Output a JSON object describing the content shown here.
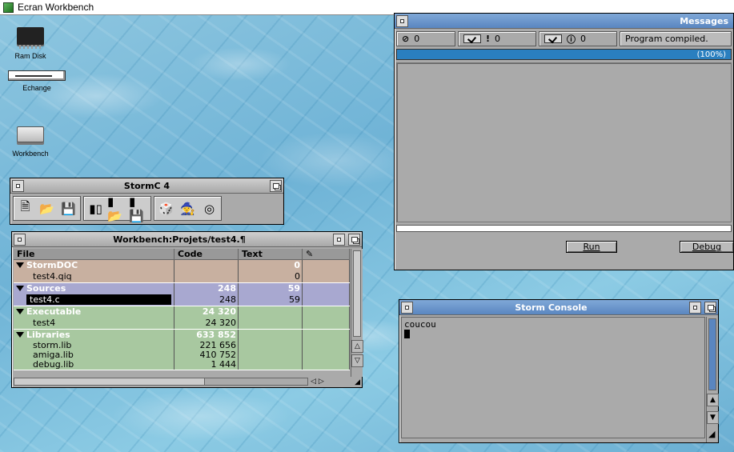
{
  "screen": {
    "title": "Ecran Workbench"
  },
  "desktop_icons": [
    {
      "label": "Ram Disk",
      "icon": "ram-disk-icon"
    },
    {
      "label": "Echange",
      "icon": "floppy-drive-icon"
    },
    {
      "label": "Workbench",
      "icon": "hard-disk-icon"
    }
  ],
  "messages": {
    "title": "Messages",
    "errors": "0",
    "warnings": "0",
    "infos": "0",
    "status": "Program compiled.",
    "progress_label": "(100%)",
    "progress": 1.0,
    "run_label": "Run",
    "debug_label": "Debug"
  },
  "stormc": {
    "title": "StormC 4"
  },
  "project": {
    "title": "Workbench:Projets/test4.¶",
    "columns": {
      "file": "File",
      "code": "Code",
      "text": "Text"
    },
    "groups": [
      {
        "name": "StormDOC",
        "code": "",
        "text": "0",
        "items": [
          {
            "name": "test4.qiq",
            "code": "",
            "text": "0"
          }
        ]
      },
      {
        "name": "Sources",
        "code": "248",
        "text": "59",
        "items": [
          {
            "name": "test4.c",
            "code": "248",
            "text": "59",
            "selected": true
          }
        ]
      },
      {
        "name": "Executable",
        "code": "24 320",
        "text": "",
        "items": [
          {
            "name": "test4",
            "code": "24 320",
            "text": ""
          }
        ]
      },
      {
        "name": "Libraries",
        "code": "633 852",
        "text": "",
        "items": [
          {
            "name": "storm.lib",
            "code": "221 656",
            "text": ""
          },
          {
            "name": "amiga.lib",
            "code": "410 752",
            "text": ""
          },
          {
            "name": "debug.lib",
            "code": "1 444",
            "text": ""
          }
        ]
      }
    ]
  },
  "console": {
    "title": "Storm Console",
    "output": "coucou"
  },
  "colors": {
    "progress": "#2a7fbf",
    "active_title": "#5a86c0",
    "doc_group": "#c8b0a0",
    "src_group": "#a8a8d0",
    "lib_group": "#a8c8a0"
  }
}
